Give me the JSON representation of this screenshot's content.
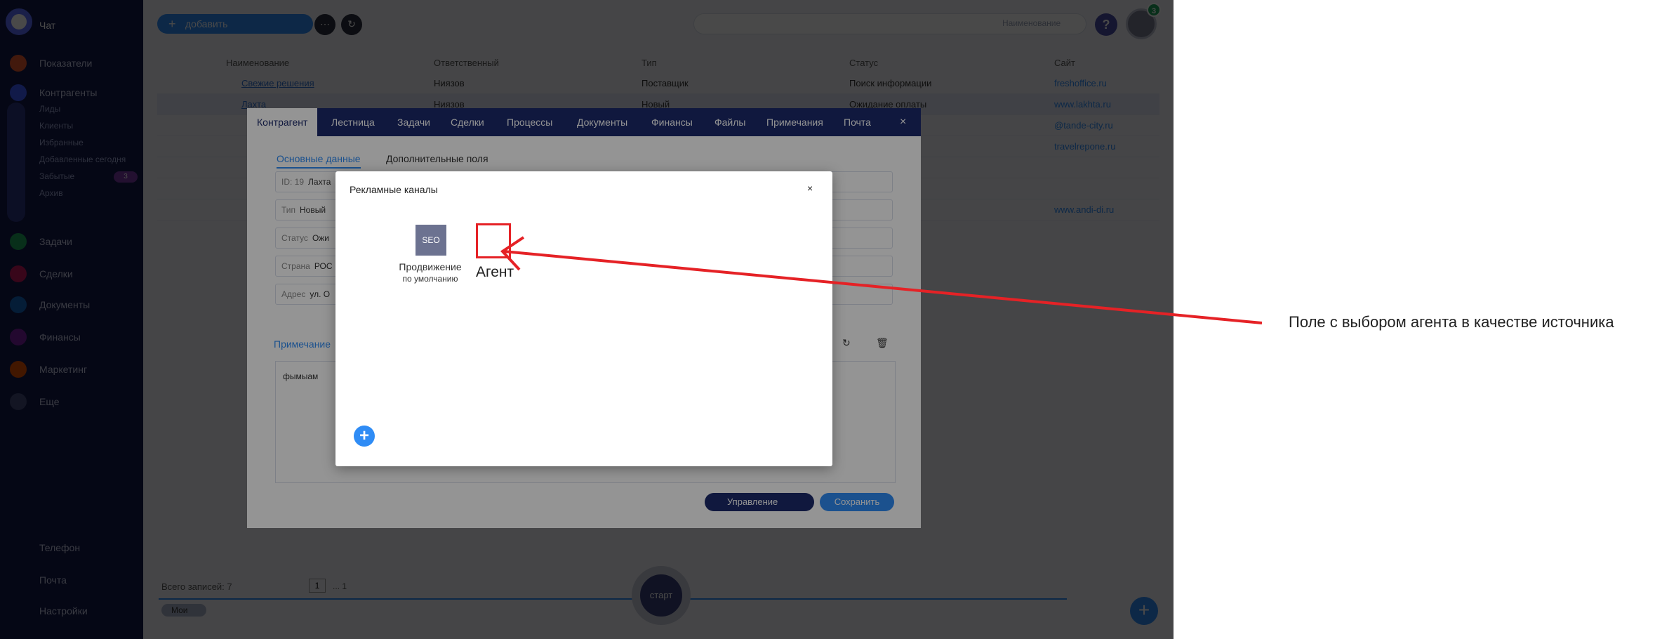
{
  "sidebar": {
    "chat": "Чат",
    "items": [
      {
        "label": "Показатели",
        "color": "#e4572e"
      },
      {
        "label": "Контрагенты",
        "color": "#3d5afe"
      },
      {
        "label": "Задачи",
        "color": "#1fa35b"
      },
      {
        "label": "Сделки",
        "color": "#c2185b"
      },
      {
        "label": "Документы",
        "color": "#1565c0"
      },
      {
        "label": "Финансы",
        "color": "#7b1fa2"
      },
      {
        "label": "Маркетинг",
        "color": "#e65100"
      },
      {
        "label": "Еще",
        "color": "#424a7a"
      }
    ],
    "sub_items": [
      "Лиды",
      "Клиенты",
      "Избранные",
      "Добавленные сегодня",
      "Забытые",
      "Архив"
    ],
    "forgotten_count": "3",
    "bottom": [
      {
        "label": "Телефон"
      },
      {
        "label": "Почта"
      },
      {
        "label": "Настройки"
      }
    ]
  },
  "topbar": {
    "add_label": "добавить",
    "search_placeholder": "Наименование",
    "help": "?",
    "notifications": "3"
  },
  "table": {
    "headers": [
      "Наименование",
      "Ответственный",
      "Тип",
      "Статус",
      "Сайт"
    ],
    "rows": [
      {
        "name": "Свежие решения",
        "owner": "Ниязов",
        "type": "Поставщик",
        "status": "Поиск информации",
        "site": "freshoffice.ru"
      },
      {
        "name": "Лахта",
        "owner": "Ниязов",
        "type": "Новый",
        "status": "Ожидание оплаты",
        "site": "www.lakhta.ru"
      },
      {
        "name": "",
        "owner": "",
        "type": "",
        "status": "",
        "site": "@tande-city.ru"
      },
      {
        "name": "",
        "owner": "",
        "type": "",
        "status": "",
        "site": "travelrepone.ru"
      },
      {
        "name": "",
        "owner": "",
        "type": "",
        "status": "",
        "site": ""
      },
      {
        "name": "",
        "owner": "",
        "type": "",
        "status": "",
        "site": ""
      },
      {
        "name": "",
        "owner": "",
        "type": "",
        "status": "",
        "site": "www.andi-di.ru"
      }
    ]
  },
  "footer": {
    "total": "Всего записей: 7",
    "page": "1",
    "pages": "... 1",
    "chip": "Мои",
    "start": "старт"
  },
  "counterparty": {
    "tabs": [
      "Контрагент",
      "Лестница",
      "Задачи",
      "Сделки",
      "Процессы",
      "Документы",
      "Финансы",
      "Файлы",
      "Примечания",
      "Почта"
    ],
    "close": "×",
    "sub_tabs": [
      "Основные данные",
      "Дополнительные поля"
    ],
    "fields": [
      {
        "label": "ID: 19",
        "value": "Лахта"
      },
      {
        "label": "Тип",
        "value": "Новый"
      },
      {
        "label": "Статус",
        "value": "Ожи"
      },
      {
        "label": "Страна",
        "value": "РОС"
      },
      {
        "label": "Адрес",
        "value": "ул. О"
      }
    ],
    "notes_title": "Примечание",
    "notes_text": "фымыам",
    "manage": "Управление",
    "save": "Сохранить"
  },
  "ad_modal": {
    "title": "Рекламные каналы",
    "close": "×",
    "seo_icon": "SEO",
    "seo_name": "Продвижение",
    "seo_default": "по умолчанию",
    "agent_name": "Агент",
    "add": "+"
  },
  "annotation": {
    "text": "Поле с выбором агента в качестве источника",
    "color": "#e52226"
  }
}
